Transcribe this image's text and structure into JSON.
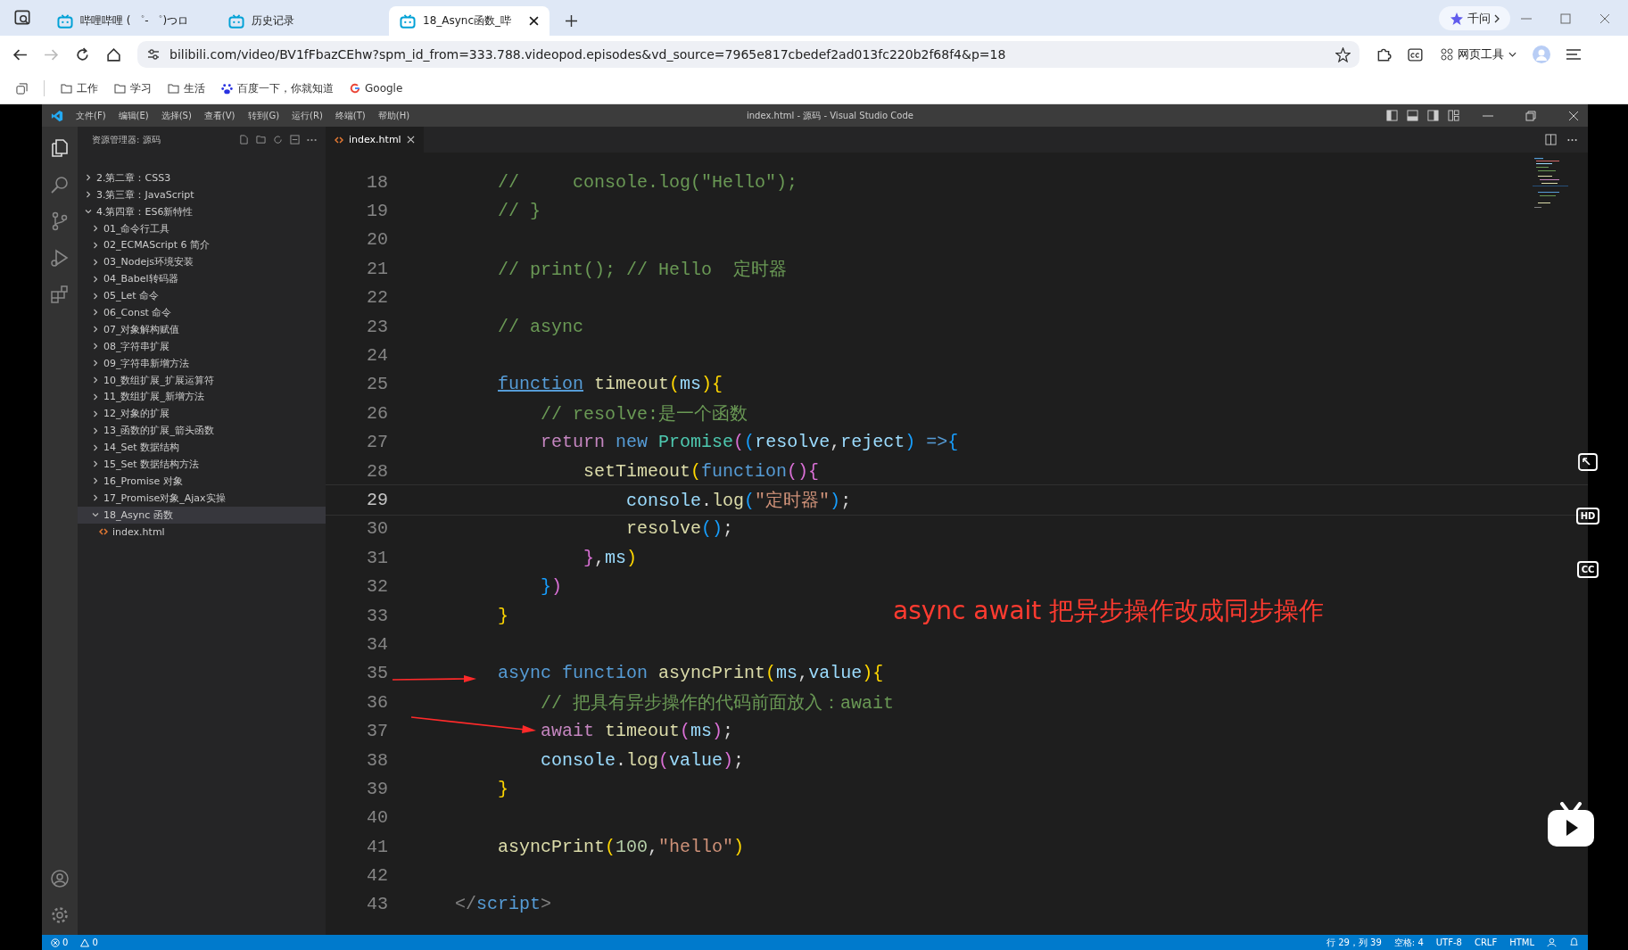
{
  "browser": {
    "tabs": [
      {
        "title": "哔哩哔哩 ( ゜- ゜)つロ",
        "selected": false
      },
      {
        "title": "历史记录",
        "selected": false
      },
      {
        "title": "18_Async函数_哔",
        "selected": true
      }
    ],
    "qianwen": "千问",
    "address": "bilibili.com/video/BV1fFbazCEhw?spm_id_from=333.788.videopod.episodes&vd_source=7965e817cbedef2ad013fc220b2f68f4&p=18",
    "tools": "网页工具",
    "bookmarks": [
      {
        "kind": "folder",
        "label": "工作"
      },
      {
        "kind": "folder",
        "label": "学习"
      },
      {
        "kind": "folder",
        "label": "生活"
      },
      {
        "kind": "paw",
        "label": "百度一下，你就知道"
      },
      {
        "kind": "google",
        "label": "Google"
      }
    ]
  },
  "vscode": {
    "menu": [
      "文件(F)",
      "编辑(E)",
      "选择(S)",
      "查看(V)",
      "转到(G)",
      "运行(R)",
      "终端(T)",
      "帮助(H)"
    ],
    "title": "index.html - 源码 - Visual Studio Code",
    "explorer_title": "资源管理器: 源码",
    "tree": [
      {
        "label": "2.第二章：CSS3",
        "expanded": false,
        "selected": false
      },
      {
        "label": "3.第三章：JavaScript",
        "expanded": false,
        "selected": false
      },
      {
        "label": "4.第四章：ES6新特性",
        "expanded": true,
        "selected": false,
        "children": [
          {
            "label": "01_命令行工具",
            "expanded": false,
            "selected": false
          },
          {
            "label": "02_ECMAScript 6 简介",
            "expanded": false,
            "selected": false
          },
          {
            "label": "03_Nodejs环境安装",
            "expanded": false,
            "selected": false
          },
          {
            "label": "04_Babel转码器",
            "expanded": false,
            "selected": false
          },
          {
            "label": "05_Let 命令",
            "expanded": false,
            "selected": false
          },
          {
            "label": "06_Const 命令",
            "expanded": false,
            "selected": false
          },
          {
            "label": "07_对象解构赋值",
            "expanded": false,
            "selected": false
          },
          {
            "label": "08_字符串扩展",
            "expanded": false,
            "selected": false
          },
          {
            "label": "09_字符串新增方法",
            "expanded": false,
            "selected": false
          },
          {
            "label": "10_数组扩展_扩展运算符",
            "expanded": false,
            "selected": false
          },
          {
            "label": "11_数组扩展_新增方法",
            "expanded": false,
            "selected": false
          },
          {
            "label": "12_对象的扩展",
            "expanded": false,
            "selected": false
          },
          {
            "label": "13_函数的扩展_箭头函数",
            "expanded": false,
            "selected": false
          },
          {
            "label": "14_Set 数据结构",
            "expanded": false,
            "selected": false
          },
          {
            "label": "15_Set 数据结构方法",
            "expanded": false,
            "selected": false
          },
          {
            "label": "16_Promise 对象",
            "expanded": false,
            "selected": false
          },
          {
            "label": "17_Promise对象_Ajax实操",
            "expanded": false,
            "selected": false
          },
          {
            "label": "18_Async 函数",
            "expanded": true,
            "selected": true,
            "children": [
              {
                "label": "index.html",
                "kind": "file",
                "selected": false
              }
            ]
          }
        ]
      }
    ],
    "editor_tab": "index.html",
    "lines": [
      {
        "n": "18",
        "current": false,
        "tokens": [
          {
            "kind": "comment",
            "text": "    //     console.log(\"Hello\");"
          }
        ]
      },
      {
        "n": "19",
        "current": false,
        "tokens": [
          {
            "kind": "comment",
            "text": "    // }"
          }
        ]
      },
      {
        "n": "20",
        "current": false
      },
      {
        "n": "21",
        "current": false,
        "tokens": [
          {
            "kind": "comment",
            "text": "    // print(); // Hello  定时器"
          }
        ]
      },
      {
        "n": "22",
        "current": false
      },
      {
        "n": "23",
        "current": false,
        "tokens": [
          {
            "kind": "comment",
            "text": "    // async"
          }
        ]
      },
      {
        "n": "24",
        "current": false
      },
      {
        "n": "25",
        "current": false,
        "tokens": [
          {
            "kind": "link",
            "text": "    function"
          },
          {
            "kind": "fn",
            "text": " timeout"
          },
          {
            "kind": "b1",
            "text": "("
          },
          {
            "kind": "var",
            "text": "ms"
          },
          {
            "kind": "b1",
            "text": "){"
          }
        ]
      },
      {
        "n": "26",
        "current": false,
        "tokens": [
          {
            "kind": "comment",
            "text": "        // resolve:是一个函数"
          }
        ]
      },
      {
        "n": "27",
        "current": false,
        "tokens": [
          {
            "kind": "control",
            "text": "        return"
          },
          {
            "kind": "keyword",
            "text": " new"
          },
          {
            "kind": "type",
            "text": " Promise"
          },
          {
            "kind": "b2",
            "text": "("
          },
          {
            "kind": "b3",
            "text": "("
          },
          {
            "kind": "var",
            "text": "resolve"
          },
          {
            "kind": "plain",
            "text": ","
          },
          {
            "kind": "var",
            "text": "reject"
          },
          {
            "kind": "b3",
            "text": ")"
          },
          {
            "kind": "keyword",
            "text": " =>"
          },
          {
            "kind": "b3",
            "text": "{"
          }
        ]
      },
      {
        "n": "28",
        "current": false,
        "tokens": [
          {
            "kind": "fn",
            "text": "            setTimeout"
          },
          {
            "kind": "b1",
            "text": "("
          },
          {
            "kind": "keyword",
            "text": "function"
          },
          {
            "kind": "b2",
            "text": "(){"
          }
        ]
      },
      {
        "n": "29",
        "current": true,
        "tokens": [
          {
            "kind": "var",
            "text": "                console"
          },
          {
            "kind": "plain",
            "text": "."
          },
          {
            "kind": "fn",
            "text": "log"
          },
          {
            "kind": "b3",
            "text": "("
          },
          {
            "kind": "str",
            "text": "\"定时器\""
          },
          {
            "kind": "b3",
            "text": ")"
          },
          {
            "kind": "plain",
            "text": ";"
          }
        ]
      },
      {
        "n": "30",
        "current": false,
        "tokens": [
          {
            "kind": "fn",
            "text": "                resolve"
          },
          {
            "kind": "b3",
            "text": "()"
          },
          {
            "kind": "plain",
            "text": ";"
          }
        ]
      },
      {
        "n": "31",
        "current": false,
        "tokens": [
          {
            "kind": "b2",
            "text": "            }"
          },
          {
            "kind": "plain",
            "text": ","
          },
          {
            "kind": "var",
            "text": "ms"
          },
          {
            "kind": "b1",
            "text": ")"
          }
        ]
      },
      {
        "n": "32",
        "current": false,
        "tokens": [
          {
            "kind": "b3",
            "text": "        }"
          },
          {
            "kind": "b2",
            "text": ")"
          }
        ]
      },
      {
        "n": "33",
        "current": false,
        "tokens": [
          {
            "kind": "b1",
            "text": "    }"
          }
        ]
      },
      {
        "n": "34",
        "current": false
      },
      {
        "n": "35",
        "current": false,
        "tokens": [
          {
            "kind": "keyword",
            "text": "    async function"
          },
          {
            "kind": "fn",
            "text": " asyncPrint"
          },
          {
            "kind": "b1",
            "text": "("
          },
          {
            "kind": "var",
            "text": "ms"
          },
          {
            "kind": "plain",
            "text": ","
          },
          {
            "kind": "var",
            "text": "value"
          },
          {
            "kind": "b1",
            "text": "){"
          }
        ]
      },
      {
        "n": "36",
        "current": false,
        "tokens": [
          {
            "kind": "comment",
            "text": "        // 把具有异步操作的代码前面放入：await"
          }
        ]
      },
      {
        "n": "37",
        "current": false,
        "tokens": [
          {
            "kind": "control",
            "text": "        await"
          },
          {
            "kind": "fn",
            "text": " timeout"
          },
          {
            "kind": "b2",
            "text": "("
          },
          {
            "kind": "var",
            "text": "ms"
          },
          {
            "kind": "b2",
            "text": ")"
          },
          {
            "kind": "plain",
            "text": ";"
          }
        ]
      },
      {
        "n": "38",
        "current": false,
        "tokens": [
          {
            "kind": "var",
            "text": "        console"
          },
          {
            "kind": "plain",
            "text": "."
          },
          {
            "kind": "fn",
            "text": "log"
          },
          {
            "kind": "b2",
            "text": "("
          },
          {
            "kind": "var",
            "text": "value"
          },
          {
            "kind": "b2",
            "text": ")"
          },
          {
            "kind": "plain",
            "text": ";"
          }
        ]
      },
      {
        "n": "39",
        "current": false,
        "tokens": [
          {
            "kind": "b1",
            "text": "    }"
          }
        ]
      },
      {
        "n": "40",
        "current": false
      },
      {
        "n": "41",
        "current": false,
        "tokens": [
          {
            "kind": "fn",
            "text": "    asyncPrint"
          },
          {
            "kind": "b1",
            "text": "("
          },
          {
            "kind": "num",
            "text": "100"
          },
          {
            "kind": "plain",
            "text": ","
          },
          {
            "kind": "str",
            "text": "\"hello\""
          },
          {
            "kind": "b1",
            "text": ")"
          }
        ]
      },
      {
        "n": "42",
        "current": false
      },
      {
        "n": "43",
        "current": false,
        "tokens": [
          {
            "kind": "tag",
            "text": "</"
          },
          {
            "kind": "tagname",
            "text": "script"
          },
          {
            "kind": "tag",
            "text": ">"
          }
        ]
      }
    ],
    "annotation": "async await 把异步操作改成同步操作",
    "status_left": [
      {
        "kind": "error",
        "count": "0"
      },
      {
        "kind": "warning",
        "count": "0"
      }
    ],
    "status_right": [
      "行 29，列 39",
      "空格: 4",
      "UTF-8",
      "CRLF",
      "HTML"
    ]
  },
  "player_buttons": [
    {
      "kind": "expand"
    },
    {
      "kind": "hd",
      "label": "HD"
    },
    {
      "kind": "cc",
      "label": "CC"
    }
  ]
}
